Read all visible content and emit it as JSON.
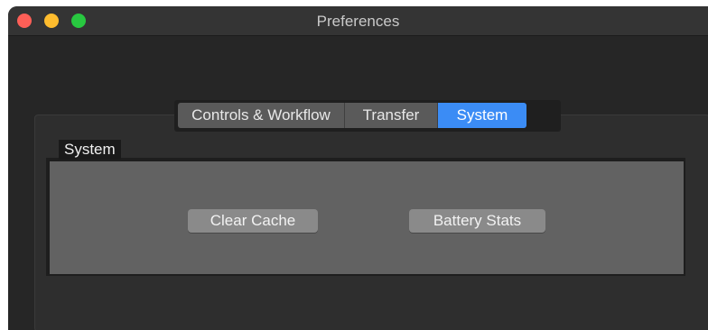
{
  "window": {
    "title": "Preferences",
    "traffic_lights": {
      "close_color": "#fe5f57",
      "minimize_color": "#febc2e",
      "zoom_color": "#28c840"
    }
  },
  "tabs": {
    "items": [
      {
        "label": "Controls & Workflow",
        "selected": false
      },
      {
        "label": "Transfer",
        "selected": false
      },
      {
        "label": "System",
        "selected": true
      }
    ],
    "accent_color": "#3b8cf5"
  },
  "system_group": {
    "label": "System",
    "buttons": {
      "clear_cache": "Clear Cache",
      "battery_stats": "Battery Stats"
    }
  }
}
